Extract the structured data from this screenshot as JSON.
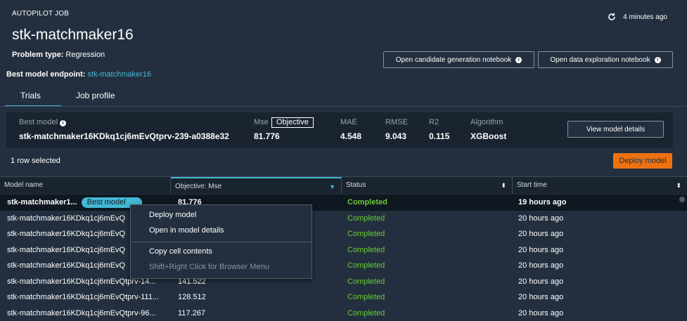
{
  "header": {
    "job_label": "AUTOPILOT JOB",
    "job_name": "stk-matchmaker16",
    "refresh_time": "4 minutes ago",
    "problem_type_label": "Problem type:",
    "problem_type_value": "Regression",
    "endpoint_label": "Best model endpoint:",
    "endpoint_value": "stk-matchmaker16",
    "btn_candidate": "Open candidate generation notebook",
    "btn_exploration": "Open data exploration notebook"
  },
  "tabs": [
    {
      "label": "Trials",
      "active": true
    },
    {
      "label": "Job profile",
      "active": false
    }
  ],
  "summary": {
    "best_model_label": "Best model",
    "best_model_name": "stk-matchmaker16KDkq1cj6mEvQtprv-239-a0388e32",
    "mse_label": "Mse",
    "objective_badge": "Objective",
    "mse_value": "81.776",
    "mae_label": "MAE",
    "mae_value": "4.548",
    "rmse_label": "RMSE",
    "rmse_value": "9.043",
    "r2_label": "R2",
    "r2_value": "0.115",
    "algorithm_label": "Algorithm",
    "algorithm_value": "XGBoost",
    "view_details_button": "View model details"
  },
  "toolbar": {
    "rows_selected": "1 row selected",
    "deploy_button": "Deploy model"
  },
  "grid": {
    "columns": [
      "Model name",
      "Objective: Mse",
      "Status",
      "Start time"
    ],
    "best_badge": "Best model",
    "rows": [
      {
        "name": "stk-matchmaker1...",
        "objective": "81.776",
        "status": "Completed",
        "start": "19 hours ago"
      },
      {
        "name": "stk-matchmaker16KDkq1cj6mEvQ",
        "objective": "",
        "status": "Completed",
        "start": "20 hours ago"
      },
      {
        "name": "stk-matchmaker16KDkq1cj6mEvQ",
        "objective": "",
        "status": "Completed",
        "start": "20 hours ago"
      },
      {
        "name": "stk-matchmaker16KDkq1cj6mEvQ",
        "objective": "",
        "status": "Completed",
        "start": "20 hours ago"
      },
      {
        "name": "stk-matchmaker16KDkq1cj6mEvQ",
        "objective": "",
        "status": "Completed",
        "start": "20 hours ago"
      },
      {
        "name": "stk-matchmaker16KDkq1cj6mEvQtprv-14...",
        "objective": "141.522",
        "status": "Completed",
        "start": "20 hours ago"
      },
      {
        "name": "stk-matchmaker16KDkq1cj6mEvQtprv-111...",
        "objective": "128.512",
        "status": "Completed",
        "start": "20 hours ago"
      },
      {
        "name": "stk-matchmaker16KDkq1cj6mEvQtprv-96...",
        "objective": "117.267",
        "status": "Completed",
        "start": "20 hours ago"
      }
    ]
  },
  "context_menu": {
    "deploy": "Deploy model",
    "open_details": "Open in model details",
    "copy": "Copy cell contents",
    "browser_menu": "Shift+Right Click for Browser Menu"
  },
  "colors": {
    "background": "#232f3e",
    "accent": "#44b9d6",
    "primary_button": "#ec7211",
    "status_completed": "#6bca3e"
  }
}
